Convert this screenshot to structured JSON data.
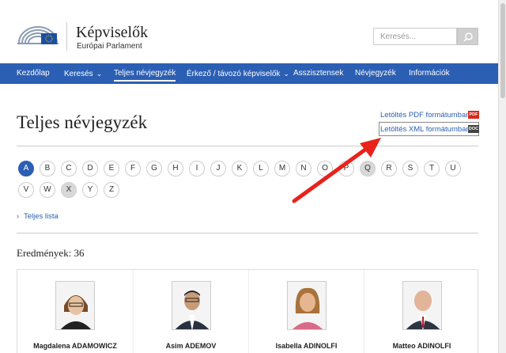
{
  "header": {
    "title": "Képviselők",
    "subtitle": "Európai Parlament",
    "search_placeholder": "Keresés..."
  },
  "nav": {
    "items": [
      {
        "label": "Kezdőlap"
      },
      {
        "label": "Keresés"
      },
      {
        "label": "Teljes névjegyzék"
      },
      {
        "label": "Érkező / távozó képviselők"
      },
      {
        "label": "Asszisztensek"
      },
      {
        "label": "Névjegyzék"
      },
      {
        "label": "Információk"
      }
    ],
    "active": "Teljes névjegyzék"
  },
  "main": {
    "title": "Teljes névjegyzék",
    "download_pdf": "Letöltés PDF formátumban",
    "download_xml": "Letöltés XML formátumban",
    "pdf_badge": "PDF",
    "doc_badge": "DOC",
    "full_list": "Teljes lista",
    "results": "Eredmények: 36"
  },
  "alphabet": {
    "row1": [
      "A",
      "B",
      "C",
      "D",
      "E",
      "F",
      "G",
      "H",
      "I",
      "J",
      "K",
      "L",
      "M",
      "N",
      "O",
      "P",
      "Q",
      "R",
      "S",
      "T",
      "U"
    ],
    "row2": [
      "V",
      "W",
      "X",
      "Y",
      "Z"
    ],
    "selected": "A",
    "disabled": [
      "Q",
      "X"
    ]
  },
  "members": [
    {
      "name": "Magdalena ADAMOWICZ"
    },
    {
      "name": "Asim ADEMOV"
    },
    {
      "name": "Isabella ADINOLFI"
    },
    {
      "name": "Matteo ADINOLFI"
    }
  ],
  "colors": {
    "nav_bg": "#2b5fb4",
    "accent": "#2b5fb4",
    "arrow": "#e8221b"
  }
}
